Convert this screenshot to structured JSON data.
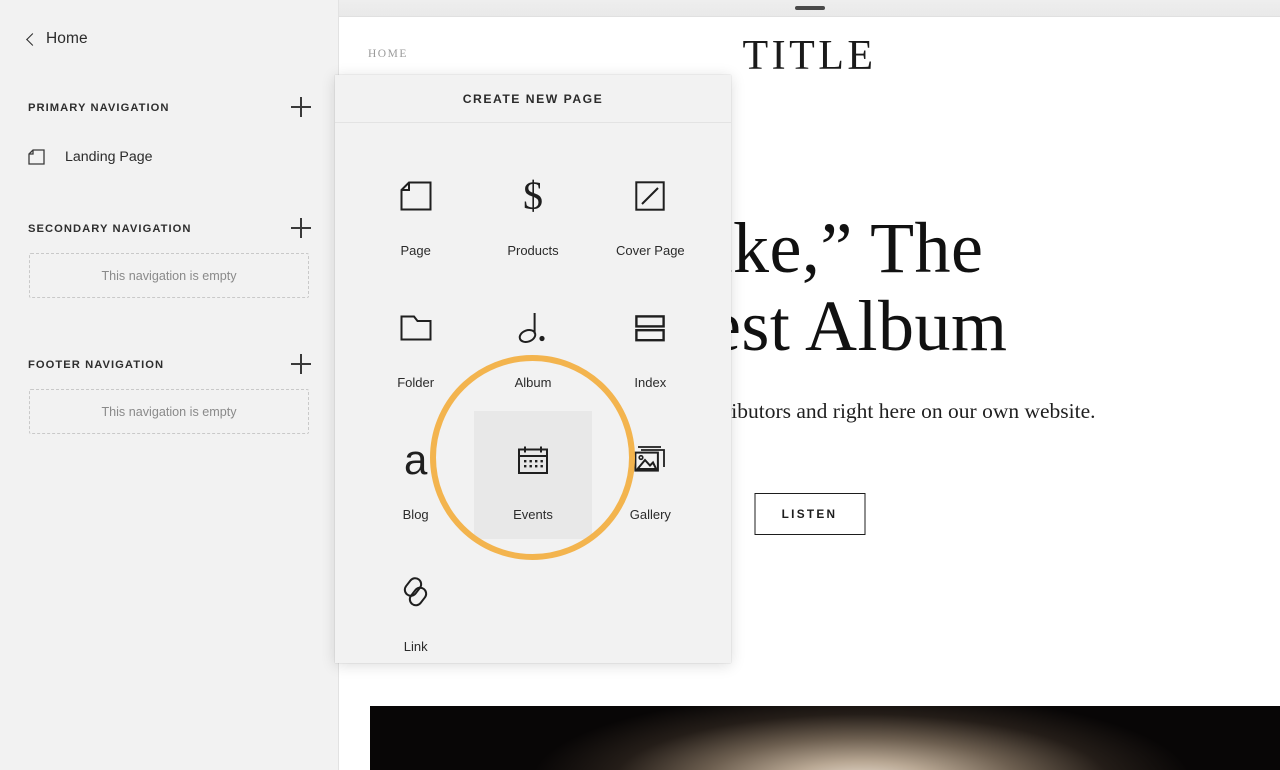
{
  "sidebar": {
    "back": {
      "label": "Home",
      "icon": "chevron-left-icon"
    },
    "sections": [
      {
        "title": "PRIMARY NAVIGATION",
        "add_icon": "plus-icon",
        "items": [
          {
            "label": "Landing Page",
            "icon": "page-icon"
          }
        ],
        "empty_text": null
      },
      {
        "title": "SECONDARY NAVIGATION",
        "add_icon": "plus-icon",
        "items": [],
        "empty_text": "This navigation is empty"
      },
      {
        "title": "FOOTER NAVIGATION",
        "add_icon": "plus-icon",
        "items": [],
        "empty_text": "This navigation is empty"
      }
    ]
  },
  "create_new_page": {
    "header": "CREATE NEW PAGE",
    "highlight_item": "Events",
    "highlight_color": "#f3b44e",
    "items": [
      {
        "label": "Page",
        "icon": "page-icon",
        "hovered": false
      },
      {
        "label": "Products",
        "icon": "dollar-icon",
        "hovered": false
      },
      {
        "label": "Cover Page",
        "icon": "cover-page-icon",
        "hovered": false
      },
      {
        "label": "Folder",
        "icon": "folder-icon",
        "hovered": false
      },
      {
        "label": "Album",
        "icon": "music-note-icon",
        "hovered": false
      },
      {
        "label": "Index",
        "icon": "index-icon",
        "hovered": false
      },
      {
        "label": "Blog",
        "icon": "letter-a-icon",
        "hovered": false
      },
      {
        "label": "Events",
        "icon": "calendar-icon",
        "hovered": true
      },
      {
        "label": "Gallery",
        "icon": "gallery-icon",
        "hovered": false
      },
      {
        "label": "Link",
        "icon": "link-icon",
        "hovered": false
      }
    ]
  },
  "preview": {
    "drag_handle": "drag-handle",
    "nav_home": "HOME",
    "site_title": "TITLE",
    "hero_heading": "“Juke,” The\nLatest Album",
    "hero_subtext": "...ugh online music distributors and right here on our own website.",
    "cta_label": "LISTEN"
  }
}
